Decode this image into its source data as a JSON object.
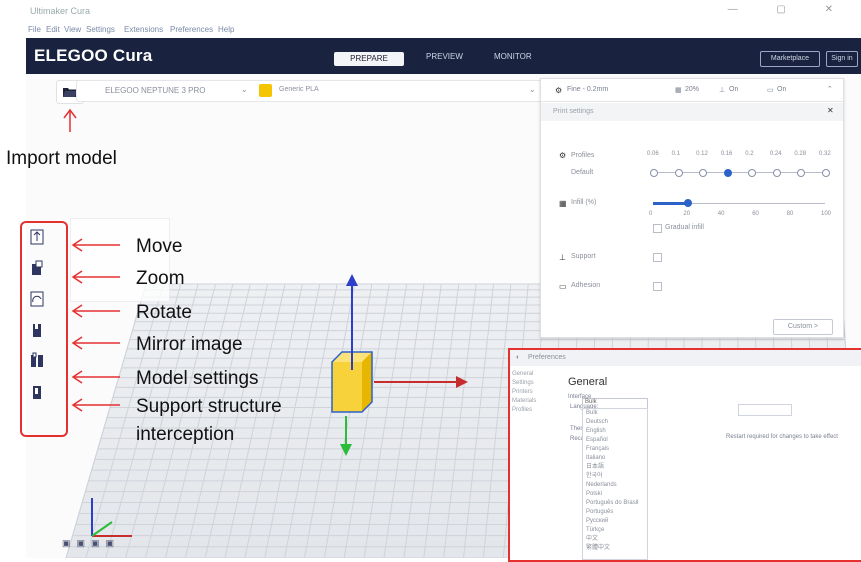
{
  "window": {
    "title": "Ultimaker Cura",
    "menu": [
      "File",
      "Edit",
      "View",
      "Settings",
      "Extensions",
      "Preferences",
      "Help"
    ]
  },
  "header": {
    "logo": "ELEGOO Cura",
    "stages": [
      "PREPARE",
      "PREVIEW",
      "MONITOR"
    ],
    "marketplace": "Marketplace",
    "signin": "Sign in"
  },
  "jobbar": {
    "printer": "ELEGOO NEPTUNE 3 PRO",
    "material": "Generic PLA"
  },
  "panel": {
    "title": "Fine - 0.2mm",
    "infill_pct": "20%",
    "support_state": "On",
    "adhesion_state": "On",
    "subtitle": "Print settings",
    "profiles_label": "Profiles",
    "default_label": "Default",
    "layer_heights": [
      "0.06",
      "0.1",
      "0.12",
      "0.16",
      "0.2",
      "0.24",
      "0.28",
      "0.32"
    ],
    "selected_profile_index": 3,
    "infill_label": "Infill (%)",
    "infill_ticks": [
      "0",
      "20",
      "40",
      "60",
      "80",
      "100"
    ],
    "infill_value": 20,
    "gradual_label": "Gradual infill",
    "support_label": "Support",
    "adhesion_label": "Adhesion",
    "custom_button": "Custom >"
  },
  "annotations": {
    "import": "Import model",
    "move": "Move",
    "zoom": "Zoom",
    "rotate": "Rotate",
    "mirror": "Mirror image",
    "model_settings": "Model settings",
    "support_structure": "Support structure",
    "interception": "interception"
  },
  "dialog": {
    "title": "Preferences",
    "nav": [
      "General",
      "Settings",
      "Printers",
      "Materials",
      "Profiles"
    ],
    "heading": "General",
    "interface_label": "Interface",
    "language_label": "Language:",
    "language_value": "Bulk",
    "theme_label": "Theme:",
    "recalc_label": "Recalculate",
    "notice": "Restart required for changes to take effect",
    "languages": [
      "Bulk",
      "Deutsch",
      "English",
      "Español",
      "Français",
      "Italiano",
      "日本語",
      "한국어",
      "Nederlands",
      "Polski",
      "Português do Brasil",
      "Português",
      "Русский",
      "Türkçe",
      "中文",
      "繁體中文"
    ]
  },
  "colors": {
    "header_bg": "#19233f",
    "accent_blue": "#2d63c8",
    "annotation_red": "#e53030",
    "model_yellow": "#f4c500"
  },
  "icons": {
    "open_file": "folder-open-icon",
    "move": "move-icon",
    "scale": "scale-icon",
    "rotate": "rotate-icon",
    "mirror": "mirror-icon",
    "per_model": "per-model-settings-icon",
    "support_blocker": "support-blocker-icon"
  }
}
